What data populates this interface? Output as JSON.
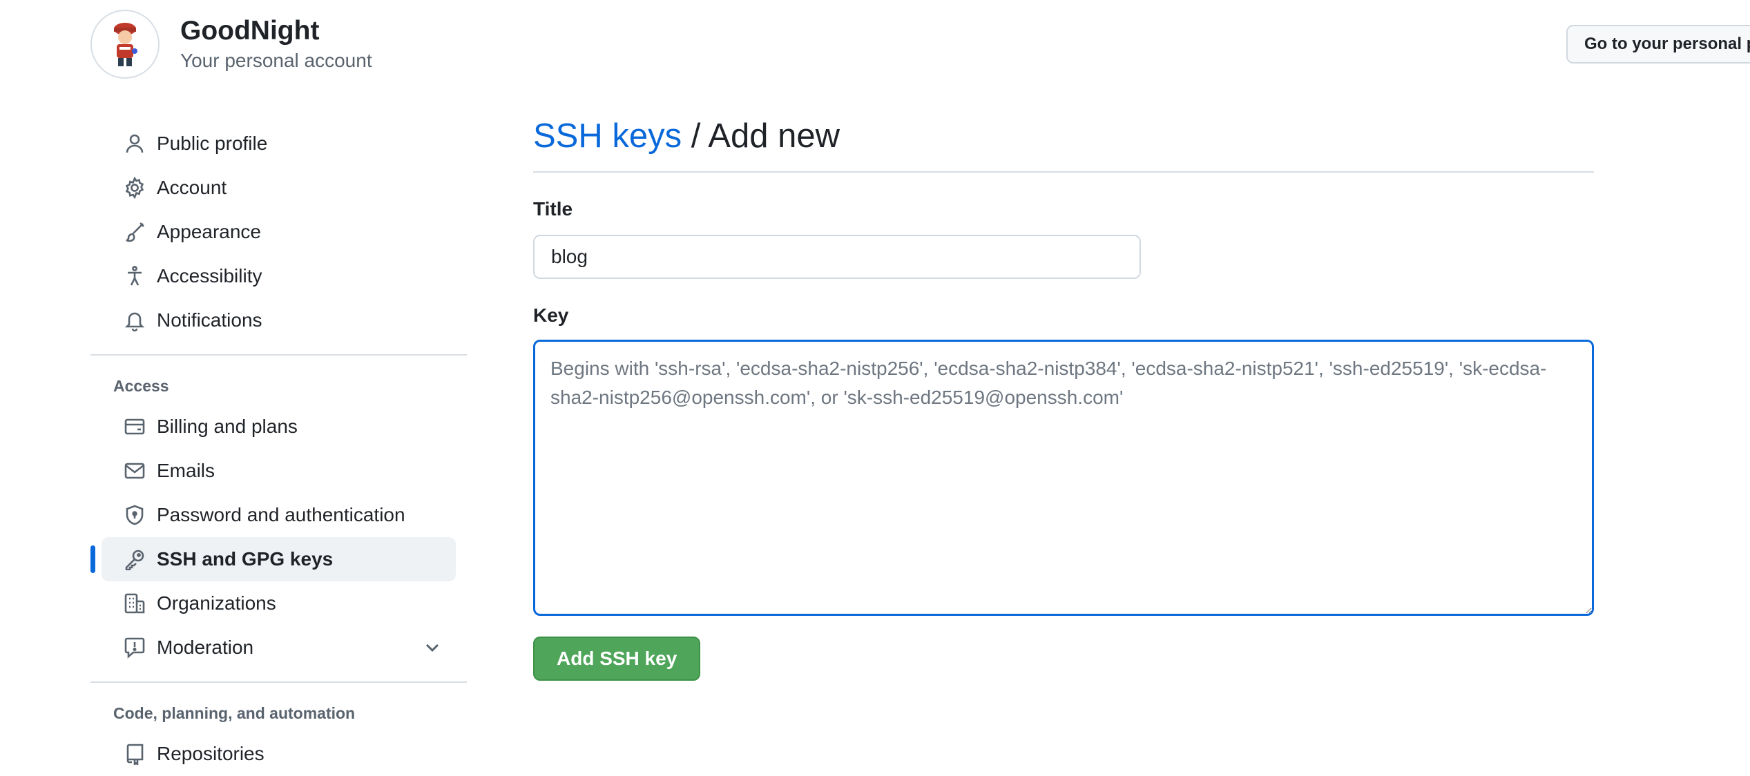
{
  "header": {
    "account_name": "GoodNight",
    "account_subtitle": "Your personal account",
    "go_personal_label": "Go to your personal p"
  },
  "sidebar": {
    "items": [
      {
        "label": "Public profile",
        "icon": "person-icon"
      },
      {
        "label": "Account",
        "icon": "gear-icon"
      },
      {
        "label": "Appearance",
        "icon": "paintbrush-icon"
      },
      {
        "label": "Accessibility",
        "icon": "accessibility-icon"
      },
      {
        "label": "Notifications",
        "icon": "bell-icon"
      }
    ],
    "access_heading": "Access",
    "access_items": [
      {
        "label": "Billing and plans",
        "icon": "credit-card-icon"
      },
      {
        "label": "Emails",
        "icon": "mail-icon"
      },
      {
        "label": "Password and authentication",
        "icon": "shield-lock-icon"
      },
      {
        "label": "SSH and GPG keys",
        "icon": "key-icon",
        "active": true
      },
      {
        "label": "Organizations",
        "icon": "organization-icon"
      },
      {
        "label": "Moderation",
        "icon": "report-icon",
        "expandable": true
      }
    ],
    "code_heading": "Code, planning, and automation",
    "code_items": [
      {
        "label": "Repositories",
        "icon": "repo-icon"
      }
    ]
  },
  "main": {
    "breadcrumb_link": "SSH keys",
    "breadcrumb_separator": " / ",
    "breadcrumb_current": "Add new",
    "title_label": "Title",
    "title_value": "blog",
    "key_label": "Key",
    "key_placeholder": "Begins with 'ssh-rsa', 'ecdsa-sha2-nistp256', 'ecdsa-sha2-nistp384', 'ecdsa-sha2-nistp521', 'ssh-ed25519', 'sk-ecdsa-sha2-nistp256@openssh.com', or 'sk-ssh-ed25519@openssh.com'",
    "submit_label": "Add SSH key"
  },
  "colors": {
    "accent": "#0969da",
    "primary_button": "#4fa55a",
    "active_nav_bg": "#eff2f5"
  }
}
